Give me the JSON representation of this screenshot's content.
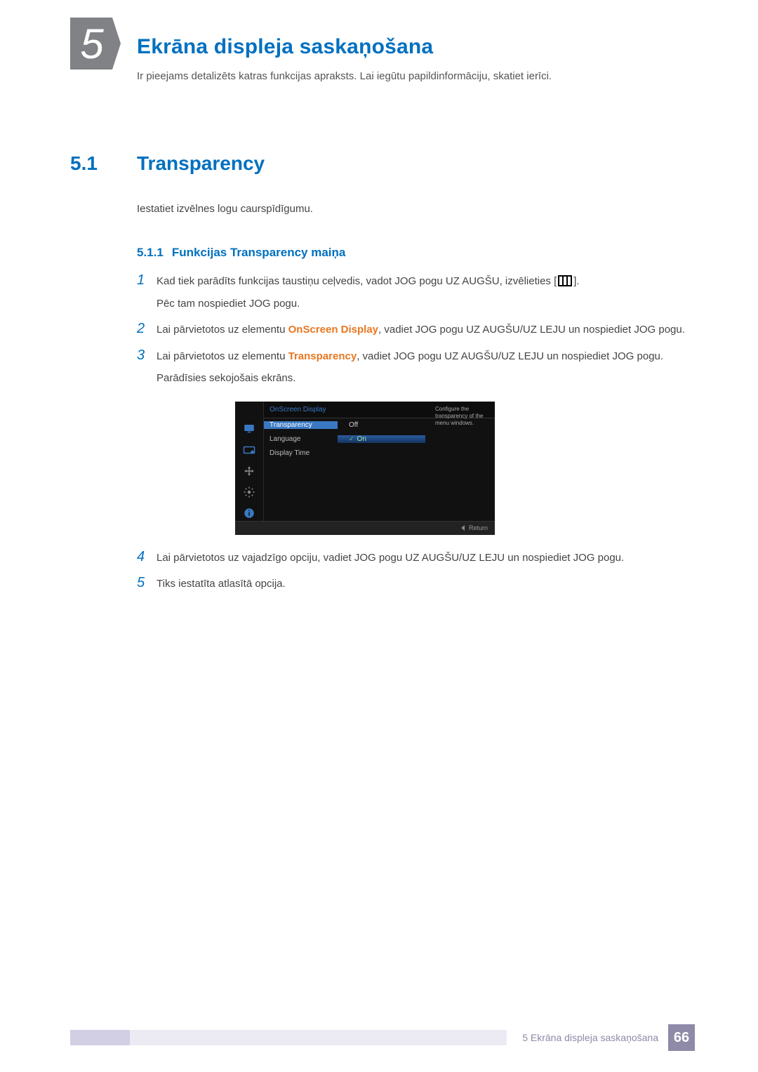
{
  "chapter": {
    "number": "5",
    "title": "Ekrāna displeja saskaņošana",
    "intro": "Ir pieejams detalizēts katras funkcijas apraksts. Lai iegūtu papildinformāciju, skatiet ierīci."
  },
  "section": {
    "number": "5.1",
    "title": "Transparency",
    "intro": "Iestatiet izvēlnes logu caurspīdīgumu."
  },
  "subsection": {
    "number": "5.1.1",
    "title": "Funkcijas Transparency maiņa"
  },
  "steps": {
    "s1": {
      "num": "1",
      "a": "Kad tiek parādīts funkcijas taustiņu ceļvedis, vadot JOG pogu UZ AUGŠU, izvēlieties [",
      "b": "].",
      "sub": "Pēc tam nospiediet JOG pogu."
    },
    "s2": {
      "num": "2",
      "a": "Lai pārvietotos uz elementu ",
      "kw": "OnScreen Display",
      "b": ", vadiet JOG pogu UZ AUGŠU/UZ LEJU un nospiediet JOG pogu."
    },
    "s3": {
      "num": "3",
      "a": "Lai pārvietotos uz elementu ",
      "kw": "Transparency",
      "b": ", vadiet JOG pogu UZ AUGŠU/UZ LEJU un nospiediet JOG pogu.",
      "sub": "Parādīsies sekojošais ekrāns."
    },
    "s4": {
      "num": "4",
      "text": "Lai pārvietotos uz vajadzīgo opciju, vadiet JOG pogu UZ AUGŠU/UZ LEJU un nospiediet JOG pogu."
    },
    "s5": {
      "num": "5",
      "text": "Tiks iestatīta atlasītā opcija."
    }
  },
  "osd": {
    "header": "OnScreen Display",
    "items": {
      "transparency": "Transparency",
      "language": "Language",
      "displaytime": "Display Time"
    },
    "values": {
      "off": "Off",
      "on": "On"
    },
    "hint": "Configure the transparency of the menu windows.",
    "return": "Return"
  },
  "footer": {
    "label": "5 Ekrāna displeja saskaņošana",
    "page": "66"
  }
}
